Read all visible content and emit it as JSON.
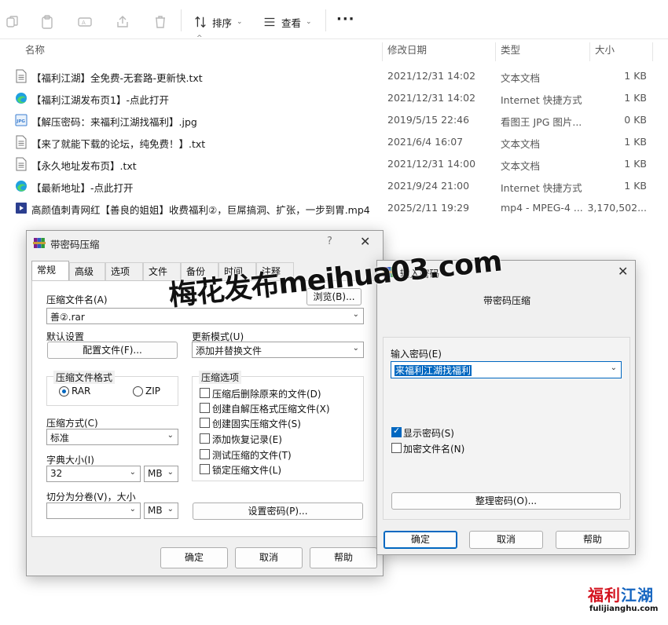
{
  "toolbar": {
    "sort_label": "排序",
    "view_label": "查看",
    "more_label": "···"
  },
  "columns": {
    "name": "名称",
    "date": "修改日期",
    "type": "类型",
    "size": "大小"
  },
  "files": [
    {
      "icon": "text-file-icon",
      "name": "【福利江湖】全免费-无套路-更新快.txt",
      "date": "2021/12/31 14:02",
      "type": "文本文档",
      "size": "1 KB"
    },
    {
      "icon": "edge-shortcut-icon",
      "name": "【福利江湖发布页1】-点此打开",
      "date": "2021/12/31 14:02",
      "type": "Internet 快捷方式",
      "size": "1 KB"
    },
    {
      "icon": "jpg-file-icon",
      "name": "【解压密码：来福利江湖找福利】.jpg",
      "date": "2019/5/15 22:46",
      "type": "看图王 JPG 图片...",
      "size": "0 KB"
    },
    {
      "icon": "text-file-icon",
      "name": "【来了就能下载的论坛，纯免费！】.txt",
      "date": "2021/6/4 16:07",
      "type": "文本文档",
      "size": "1 KB"
    },
    {
      "icon": "text-file-icon",
      "name": "【永久地址发布页】.txt",
      "date": "2021/12/31 14:00",
      "type": "文本文档",
      "size": "1 KB"
    },
    {
      "icon": "edge-shortcut-icon",
      "name": "【最新地址】-点此打开",
      "date": "2021/9/24 21:00",
      "type": "Internet 快捷方式",
      "size": "1 KB"
    },
    {
      "icon": "mp4-file-icon",
      "name": "高颜值刺青网红【善良的姐姐】收费福利②，巨屌搞洞、扩张，一步到胃.mp4",
      "date": "2025/2/11 19:29",
      "type": "mp4 - MPEG-4 ...",
      "size": "3,170,502..."
    }
  ],
  "archive_dialog": {
    "title": "带密码压缩",
    "help": "?",
    "tabs": [
      "常规",
      "高级",
      "选项",
      "文件",
      "备份",
      "时间",
      "注释"
    ],
    "archive_name_label": "压缩文件名(A)",
    "archive_name_value": "善②.rar",
    "browse_label": "浏览(B)...",
    "default_settings_label": "默认设置",
    "profiles_button": "配置文件(F)...",
    "update_mode_label": "更新模式(U)",
    "update_mode_value": "添加并替换文件",
    "format_group": "压缩文件格式",
    "format_rar": "RAR",
    "format_zip": "ZIP",
    "method_label": "压缩方式(C)",
    "method_value": "标准",
    "dict_label": "字典大小(I)",
    "dict_value": "32",
    "dict_unit": "MB",
    "split_label": "切分为分卷(V)，大小",
    "split_value": "",
    "split_unit": "MB",
    "options_group": "压缩选项",
    "options": [
      "压缩后删除原来的文件(D)",
      "创建自解压格式压缩文件(X)",
      "创建固实压缩文件(S)",
      "添加恢复记录(E)",
      "测试压缩的文件(T)",
      "锁定压缩文件(L)"
    ],
    "set_password_button": "设置密码(P)...",
    "ok": "确定",
    "cancel": "取消",
    "help_button": "帮助"
  },
  "password_dialog": {
    "title": "输入密码",
    "subtitle": "带密码压缩",
    "password_label": "输入密码(E)",
    "password_value": "来福利江湖找福利",
    "show_password": "显示密码(S)",
    "encrypt_names": "加密文件名(N)",
    "organize_button": "整理密码(O)...",
    "ok": "确定",
    "cancel": "取消",
    "help": "帮助"
  },
  "watermark": {
    "text": "梅花发布meihua03.com"
  },
  "logo": {
    "cn_red": "福利",
    "cn_blue": "江湖",
    "en": "fulijianghu.com"
  },
  "colors": {
    "accent": "#0067c0",
    "logo_red": "#d3131f",
    "logo_blue": "#1565c0"
  }
}
